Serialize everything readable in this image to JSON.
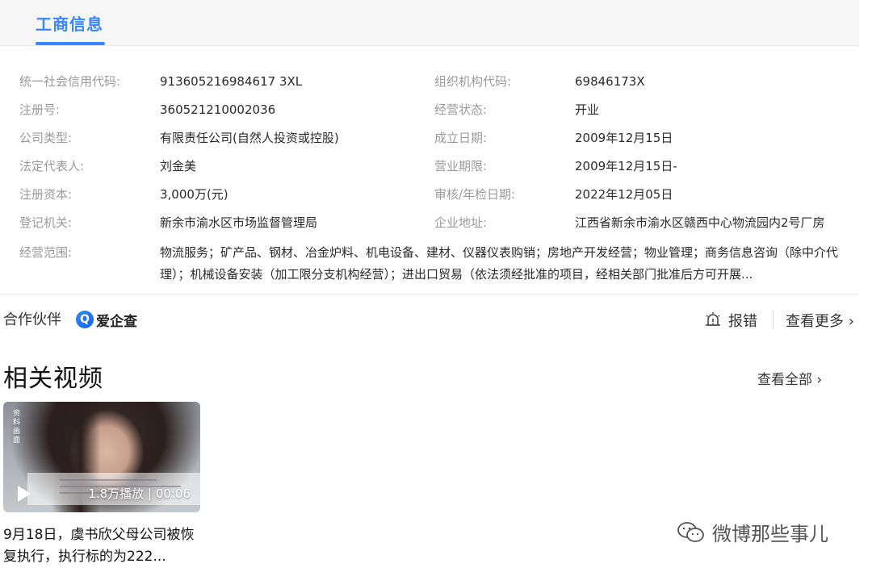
{
  "tab": {
    "label": "工商信息"
  },
  "info_rows": [
    {
      "label1": "统一社会信用代码:",
      "value1": "913605216984617 3XL",
      "label2": "组织机构代码:",
      "value2": "69846173X"
    },
    {
      "label1": "注册号:",
      "value1": "360521210002036",
      "label2": "经营状态:",
      "value2": "开业"
    },
    {
      "label1": "公司类型:",
      "value1": "有限责任公司(自然人投资或控股)",
      "label2": "成立日期:",
      "value2": "2009年12月15日"
    },
    {
      "label1": "法定代表人:",
      "value1": "刘金美",
      "label2": "营业期限:",
      "value2": "2009年12月15日-"
    },
    {
      "label1": "注册资本:",
      "value1": "3,000万(元)",
      "label2": "审核/年检日期:",
      "value2": "2022年12月05日"
    },
    {
      "label1": "登记机关:",
      "value1": "新余市渝水区市场监督管理局",
      "label2": "企业地址:",
      "value2": "江西省新余市渝水区赣西中心物流园内2号厂房"
    }
  ],
  "scope": {
    "label": "经营范围:",
    "value": "物流服务；矿产品、钢材、冶金炉料、机电设备、建材、仪器仪表购销；房地产开发经营；物业管理；商务信息咨询（除中介代理）；机械设备安装（加工限分支机构经营）；进出口贸易（依法须经批准的项目，经相关部门批准后方可开展..."
  },
  "partner": {
    "label": "合作伙伴",
    "logo_text": "爱企查",
    "logo_letter": "Q"
  },
  "actions": {
    "report": "报错",
    "more": "查看更多 ›"
  },
  "videos_section": {
    "title": "相关视频",
    "view_all": "查看全部 ›"
  },
  "video": {
    "side_text": "资料画面",
    "stats": "1.8万播放 | 00:06",
    "title": "9月18日，虞书欣父母公司被恢复执行，执行标的为222..."
  },
  "watermark": {
    "text": "微博那些事儿"
  }
}
